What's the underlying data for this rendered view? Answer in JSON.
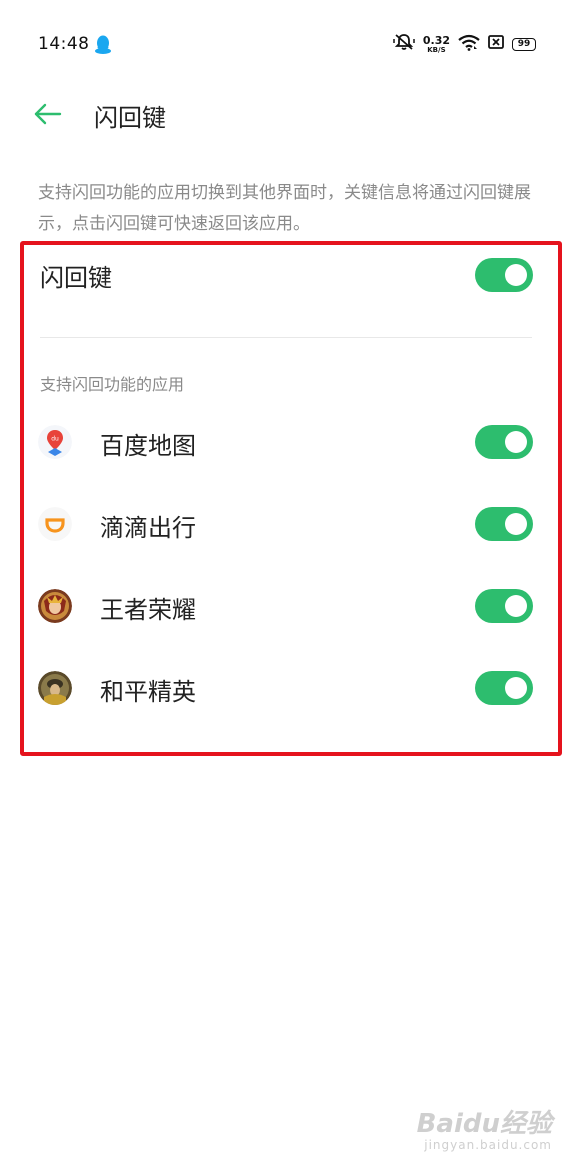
{
  "status_bar": {
    "time": "14:48",
    "net_speed_value": "0.32",
    "net_speed_unit": "KB/S",
    "battery_level": "99",
    "icons": [
      "qq-icon",
      "mute-icon",
      "wifi-icon",
      "sim-icon",
      "battery-icon"
    ]
  },
  "header": {
    "back_icon": "arrow-left-icon",
    "title": "闪回键"
  },
  "description": "支持闪回功能的应用切换到其他界面时，关键信息将通过闪回键展示，点击闪回键可快速返回该应用。",
  "main_toggle": {
    "label": "闪回键",
    "on": true
  },
  "section": {
    "header": "支持闪回功能的应用",
    "apps": [
      {
        "label": "百度地图",
        "icon": "baidu-map-icon",
        "on": true
      },
      {
        "label": "滴滴出行",
        "icon": "didi-icon",
        "on": true
      },
      {
        "label": "王者荣耀",
        "icon": "honor-of-kings-icon",
        "on": true
      },
      {
        "label": "和平精英",
        "icon": "peacekeeper-elite-icon",
        "on": true
      }
    ]
  },
  "colors": {
    "accent": "#2dbd6e",
    "highlight_border": "#e5131d",
    "secondary_text": "#8a8a8a"
  },
  "watermark": {
    "main": "Baidu经验",
    "sub": "jingyan.baidu.com"
  }
}
